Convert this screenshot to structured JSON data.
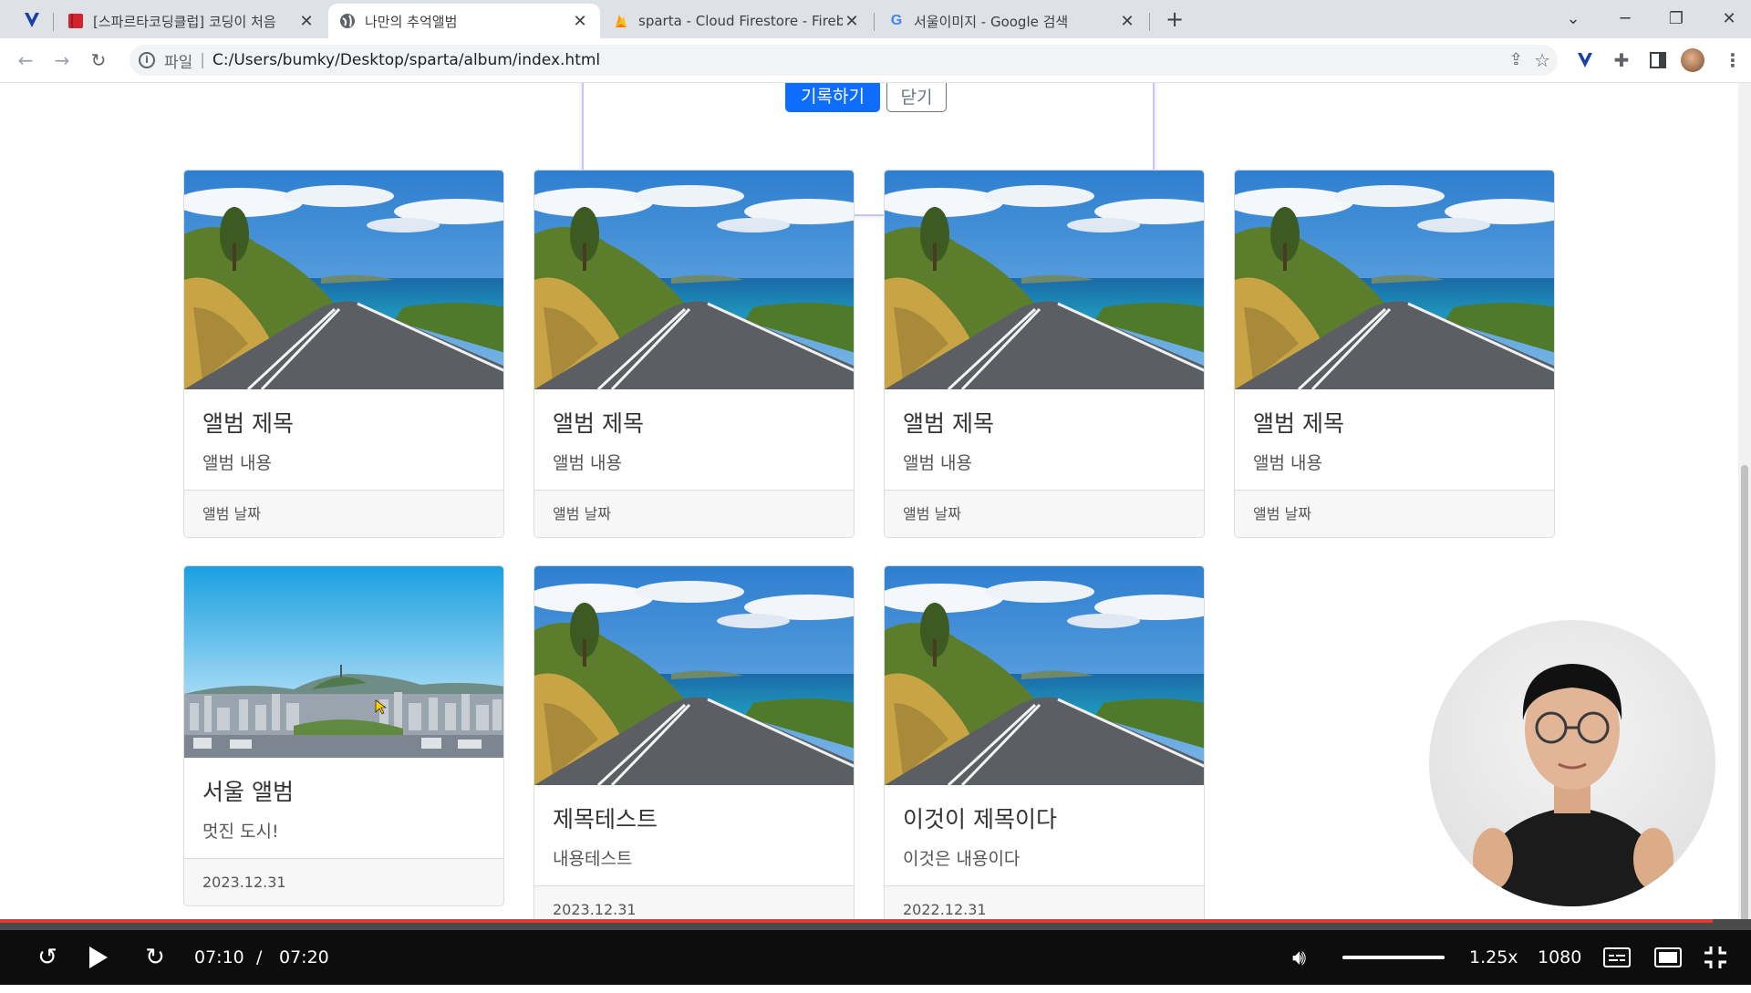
{
  "browser": {
    "tabs": [
      {
        "title": "[스파르타코딩클럽] 코딩이 처음",
        "favicon": "book-icon",
        "color": "#d1242f"
      },
      {
        "title": "나만의 추억앨범",
        "favicon": "globe-icon",
        "color": "#5f6368"
      },
      {
        "title": "sparta - Cloud Firestore - Firebase",
        "favicon": "firebase-icon",
        "color": "#f6a800"
      },
      {
        "title": "서울이미지 - Google 검색",
        "favicon": "google-icon",
        "color": "#4285f4"
      }
    ],
    "new_tab": "+",
    "address": {
      "scheme": "파일",
      "separator": "|",
      "url": "C:/Users/bumky/Desktop/sparta/album/index.html"
    }
  },
  "form": {
    "save_label": "기록하기",
    "close_label": "닫기"
  },
  "cards": [
    {
      "image": "road-photo",
      "title": "앨범 제목",
      "text": "앨범 내용",
      "date": "앨범 날짜"
    },
    {
      "image": "road-photo",
      "title": "앨범 제목",
      "text": "앨범 내용",
      "date": "앨범 날짜"
    },
    {
      "image": "road-photo",
      "title": "앨범 제목",
      "text": "앨범 내용",
      "date": "앨범 날짜"
    },
    {
      "image": "road-photo",
      "title": "앨범 제목",
      "text": "앨범 내용",
      "date": "앨범 날짜"
    },
    {
      "image": "seoul-photo",
      "title": "서울 앨범",
      "text": "멋진 도시!",
      "date": "2023.12.31"
    },
    {
      "image": "road-photo",
      "title": "제목테스트",
      "text": "내용테스트",
      "date": "2023.12.31"
    },
    {
      "image": "road-photo",
      "title": "이것이 제목이다",
      "text": "이것은 내용이다",
      "date": "2022.12.31"
    }
  ],
  "player": {
    "current_time": "07:10",
    "separator": "/",
    "total_time": "07:20",
    "speed": "1.25x",
    "quality": "1080p",
    "progress": 0.978,
    "volume": 1.0
  },
  "colors": {
    "primary": "#0d6efd",
    "progress": "#e53935"
  }
}
